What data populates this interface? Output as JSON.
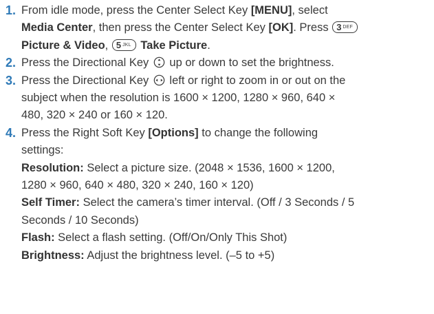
{
  "steps": [
    {
      "num": "1.",
      "t1": "From idle mode, press the Center Select Key ",
      "b1": "[MENU]",
      "t2": ", select",
      "b2": "Media Center",
      "t3": ", then press the Center Select Key ",
      "b3": "[OK]",
      "t4": ". Press ",
      "key1": {
        "digit": "3",
        "letters": "DEF"
      },
      "b4": "Picture & Video",
      "t5": ", ",
      "key2": {
        "digit": "5",
        "letters": "JKL"
      },
      "b5": "Take Picture",
      "t6": "."
    },
    {
      "num": "2.",
      "t1": "Press the Directional Key ",
      "t2": " up or down to set the brightness.",
      "icon": "up-down-navigation-key-icon"
    },
    {
      "num": "3.",
      "t1": "Press the Directional Key ",
      "t2": " left or right to zoom in or out on the",
      "t3": "subject when the resolution is 1600 × 1200, 1280 × 960, 640 ×",
      "t4": "480, 320 × 240 or 160 × 120.",
      "icon": "left-right-navigation-key-icon"
    },
    {
      "num": "4.",
      "t1": "Press the Right Soft Key ",
      "b1": "[Options]",
      "t2": " to change the following",
      "t3": "settings:"
    }
  ],
  "settings": [
    {
      "label": "Resolution:",
      "text": " Select a picture size. (2048 × 1536, 1600 × 1200,",
      "text2": "1280 × 960, 640 × 480, 320 × 240, 160 × 120)"
    },
    {
      "label": "Self Timer:",
      "text": " Select the camera’s timer interval. (Off / 3 Seconds / 5",
      "text2": "Seconds / 10 Seconds)"
    },
    {
      "label": "Flash:",
      "text": " Select a flash setting. (Off/On/Only This Shot)"
    },
    {
      "label": "Brightness:",
      "text": " Adjust the brightness level. (–5 to +5)"
    }
  ],
  "colors": {
    "step_number": "#2f7ab7",
    "text": "#3a3a3a"
  }
}
